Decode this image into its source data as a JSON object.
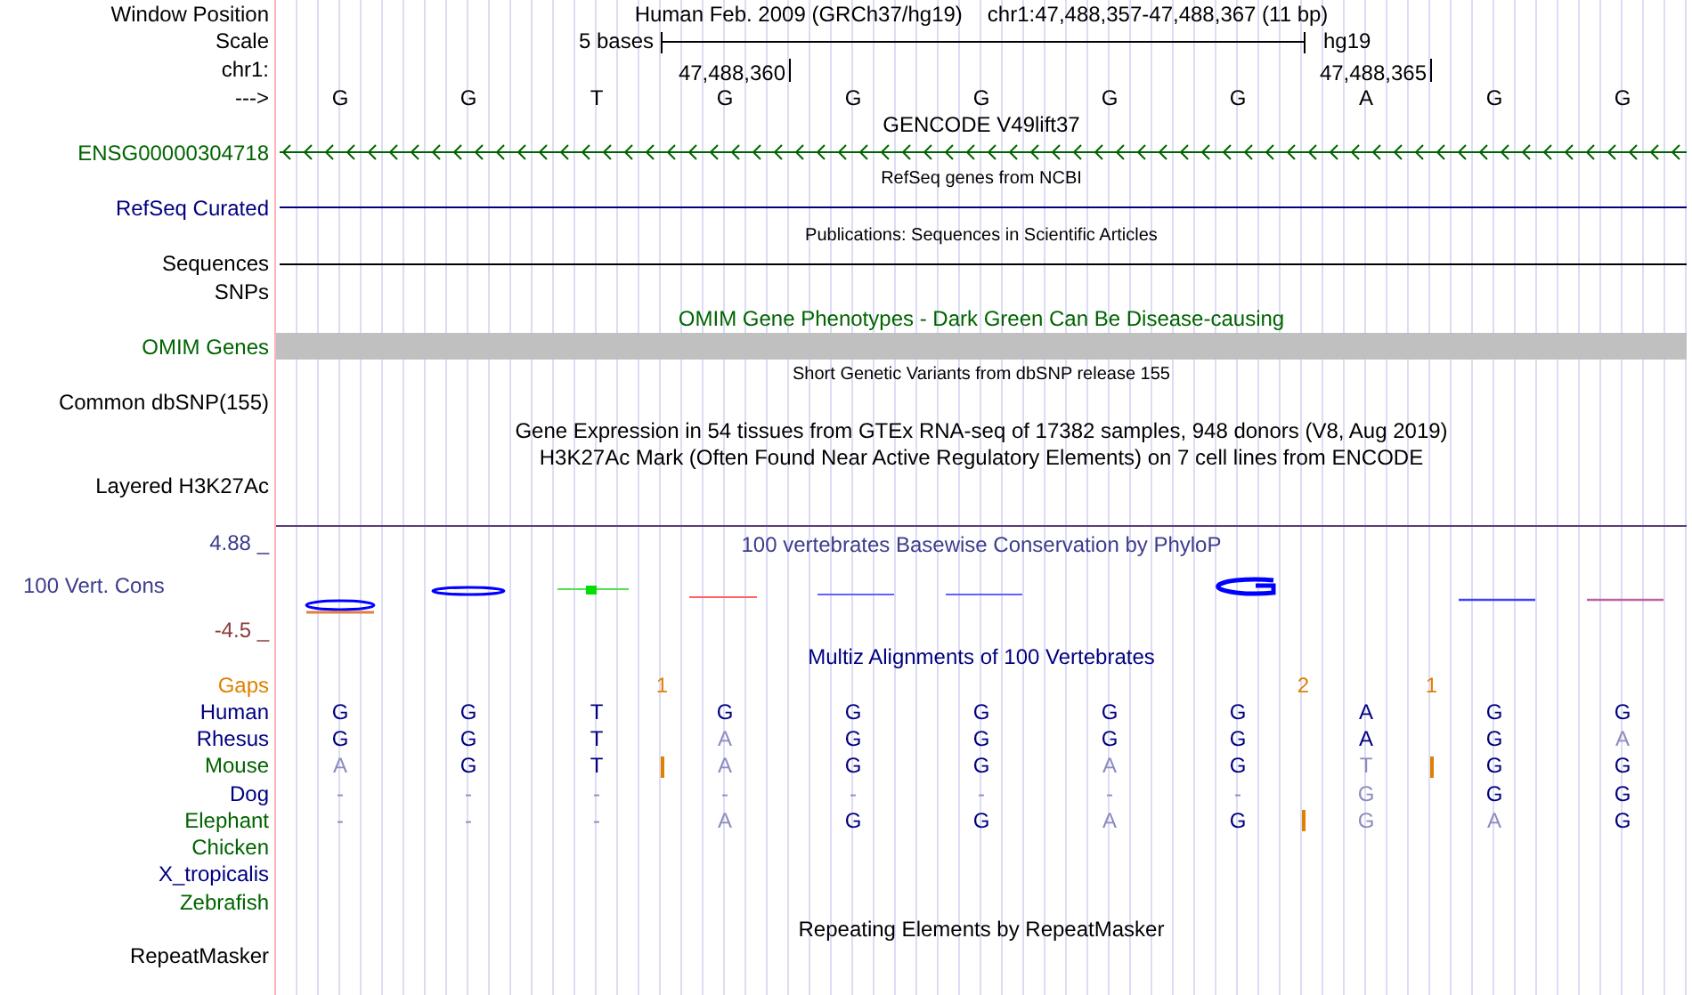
{
  "header": {
    "label": "Window Position",
    "assembly": "Human Feb. 2009 (GRCh37/hg19)",
    "range": "chr1:47,488,357-47,488,367 (11 bp)"
  },
  "scale": {
    "label": "Scale",
    "span": "5 bases",
    "db": "hg19"
  },
  "ruler": {
    "label": "chr1:",
    "ticks": [
      "47,488,360",
      "47,488,365"
    ]
  },
  "sequence": {
    "label": "--->",
    "bases": [
      "G",
      "G",
      "T",
      "G",
      "G",
      "G",
      "G",
      "G",
      "A",
      "G",
      "G"
    ]
  },
  "tracks": [
    {
      "kind": "heading",
      "text": "GENCODE V49lift37",
      "color": "#000000"
    },
    {
      "kind": "arrows",
      "label": "ENSG00000304718",
      "color": "#006400"
    },
    {
      "kind": "caption",
      "text": "RefSeq genes from NCBI",
      "color": "#000000"
    },
    {
      "kind": "line",
      "label": "RefSeq Curated",
      "color": "#000080"
    },
    {
      "kind": "caption",
      "text": "Publications: Sequences in Scientific Articles",
      "color": "#000000"
    },
    {
      "kind": "line",
      "label": "Sequences",
      "color": "#000000"
    },
    {
      "kind": "empty",
      "label": "SNPs",
      "color": "#000000"
    },
    {
      "kind": "heading",
      "text": "OMIM Gene Phenotypes - Dark Green Can Be Disease-causing",
      "color": "#006400"
    },
    {
      "kind": "bar",
      "label": "OMIM Genes",
      "color": "#006400"
    },
    {
      "kind": "caption",
      "text": "Short Genetic Variants from dbSNP release 155",
      "color": "#000000"
    },
    {
      "kind": "empty",
      "label": "Common dbSNP(155)",
      "color": "#000000"
    },
    {
      "kind": "heading",
      "text": "Gene Expression in 54 tissues from GTEx RNA-seq of 17382 samples, 948 donors (V8, Aug 2019)",
      "color": "#000000"
    },
    {
      "kind": "heading",
      "text": "H3K27Ac Mark (Often Found Near Active Regulatory Elements) on 7 cell lines from ENCODE",
      "color": "#000000"
    },
    {
      "kind": "empty",
      "label": "Layered H3K27Ac",
      "color": "#000000"
    }
  ],
  "conservation": {
    "title": "100 vertebrates Basewise Conservation by PhyloP",
    "label": "100 Vert. Cons",
    "max": "4.88 _",
    "min": "-4.5 _"
  },
  "alignment": {
    "title": "Multiz Alignments of 100 Vertebrates",
    "gaps": {
      "label": "Gaps",
      "cells": [
        {
          "kind": "none"
        },
        {
          "kind": "none"
        },
        {
          "kind": "count",
          "text": "1"
        },
        {
          "kind": "none"
        },
        {
          "kind": "none"
        },
        {
          "kind": "none"
        },
        {
          "kind": "none"
        },
        {
          "kind": "count",
          "text": "2"
        },
        {
          "kind": "count",
          "text": "1"
        },
        {
          "kind": "none"
        },
        {
          "kind": "none"
        }
      ]
    },
    "species": [
      {
        "name": "Human",
        "color": "#000080",
        "bases": [
          {
            "text": "G",
            "muted": false,
            "insert_after": false
          },
          {
            "text": "G",
            "muted": false,
            "insert_after": false
          },
          {
            "text": "T",
            "muted": false,
            "insert_after": false
          },
          {
            "text": "G",
            "muted": false,
            "insert_after": false
          },
          {
            "text": "G",
            "muted": false,
            "insert_after": false
          },
          {
            "text": "G",
            "muted": false,
            "insert_after": false
          },
          {
            "text": "G",
            "muted": false,
            "insert_after": false
          },
          {
            "text": "G",
            "muted": false,
            "insert_after": false
          },
          {
            "text": "A",
            "muted": false,
            "insert_after": false
          },
          {
            "text": "G",
            "muted": false,
            "insert_after": false
          },
          {
            "text": "G",
            "muted": false,
            "insert_after": false
          }
        ]
      },
      {
        "name": "Rhesus",
        "color": "#000080",
        "bases": [
          {
            "text": "G",
            "muted": false,
            "insert_after": false
          },
          {
            "text": "G",
            "muted": false,
            "insert_after": false
          },
          {
            "text": "T",
            "muted": false,
            "insert_after": false
          },
          {
            "text": "A",
            "muted": true,
            "insert_after": false
          },
          {
            "text": "G",
            "muted": false,
            "insert_after": false
          },
          {
            "text": "G",
            "muted": false,
            "insert_after": false
          },
          {
            "text": "G",
            "muted": false,
            "insert_after": false
          },
          {
            "text": "G",
            "muted": false,
            "insert_after": false
          },
          {
            "text": "A",
            "muted": false,
            "insert_after": false
          },
          {
            "text": "G",
            "muted": false,
            "insert_after": false
          },
          {
            "text": "A",
            "muted": true,
            "insert_after": false
          }
        ]
      },
      {
        "name": "Mouse",
        "color": "#006400",
        "bases": [
          {
            "text": "A",
            "muted": true,
            "insert_after": false
          },
          {
            "text": "G",
            "muted": false,
            "insert_after": false
          },
          {
            "text": "T",
            "muted": false,
            "insert_after": true
          },
          {
            "text": "A",
            "muted": true,
            "insert_after": false
          },
          {
            "text": "G",
            "muted": false,
            "insert_after": false
          },
          {
            "text": "G",
            "muted": false,
            "insert_after": false
          },
          {
            "text": "A",
            "muted": true,
            "insert_after": false
          },
          {
            "text": "G",
            "muted": false,
            "insert_after": false
          },
          {
            "text": "T",
            "muted": true,
            "insert_after": true
          },
          {
            "text": "G",
            "muted": false,
            "insert_after": false
          },
          {
            "text": "G",
            "muted": false,
            "insert_after": false
          }
        ]
      },
      {
        "name": "Dog",
        "color": "#000080",
        "bases": [
          {
            "text": "-",
            "muted": true,
            "insert_after": false
          },
          {
            "text": "-",
            "muted": true,
            "insert_after": false
          },
          {
            "text": "-",
            "muted": true,
            "insert_after": false
          },
          {
            "text": "-",
            "muted": true,
            "insert_after": false
          },
          {
            "text": "-",
            "muted": true,
            "insert_after": false
          },
          {
            "text": "-",
            "muted": true,
            "insert_after": false
          },
          {
            "text": "-",
            "muted": true,
            "insert_after": false
          },
          {
            "text": "-",
            "muted": true,
            "insert_after": false
          },
          {
            "text": "G",
            "muted": true,
            "insert_after": false
          },
          {
            "text": "G",
            "muted": false,
            "insert_after": false
          },
          {
            "text": "G",
            "muted": false,
            "insert_after": false
          }
        ]
      },
      {
        "name": "Elephant",
        "color": "#006400",
        "bases": [
          {
            "text": "-",
            "muted": true,
            "insert_after": false
          },
          {
            "text": "-",
            "muted": true,
            "insert_after": false
          },
          {
            "text": "-",
            "muted": true,
            "insert_after": false
          },
          {
            "text": "A",
            "muted": true,
            "insert_after": false
          },
          {
            "text": "G",
            "muted": false,
            "insert_after": false
          },
          {
            "text": "G",
            "muted": false,
            "insert_after": false
          },
          {
            "text": "A",
            "muted": true,
            "insert_after": false
          },
          {
            "text": "G",
            "muted": false,
            "insert_after": true
          },
          {
            "text": "G",
            "muted": true,
            "insert_after": false
          },
          {
            "text": "A",
            "muted": true,
            "insert_after": false
          },
          {
            "text": "G",
            "muted": false,
            "insert_after": false
          }
        ]
      },
      {
        "name": "Chicken",
        "color": "#006400"
      },
      {
        "name": "X_tropicalis",
        "color": "#000080"
      },
      {
        "name": "Zebrafish",
        "color": "#006400"
      }
    ]
  },
  "repeats": {
    "title": "Repeating Elements by RepeatMasker",
    "label": "RepeatMasker"
  }
}
